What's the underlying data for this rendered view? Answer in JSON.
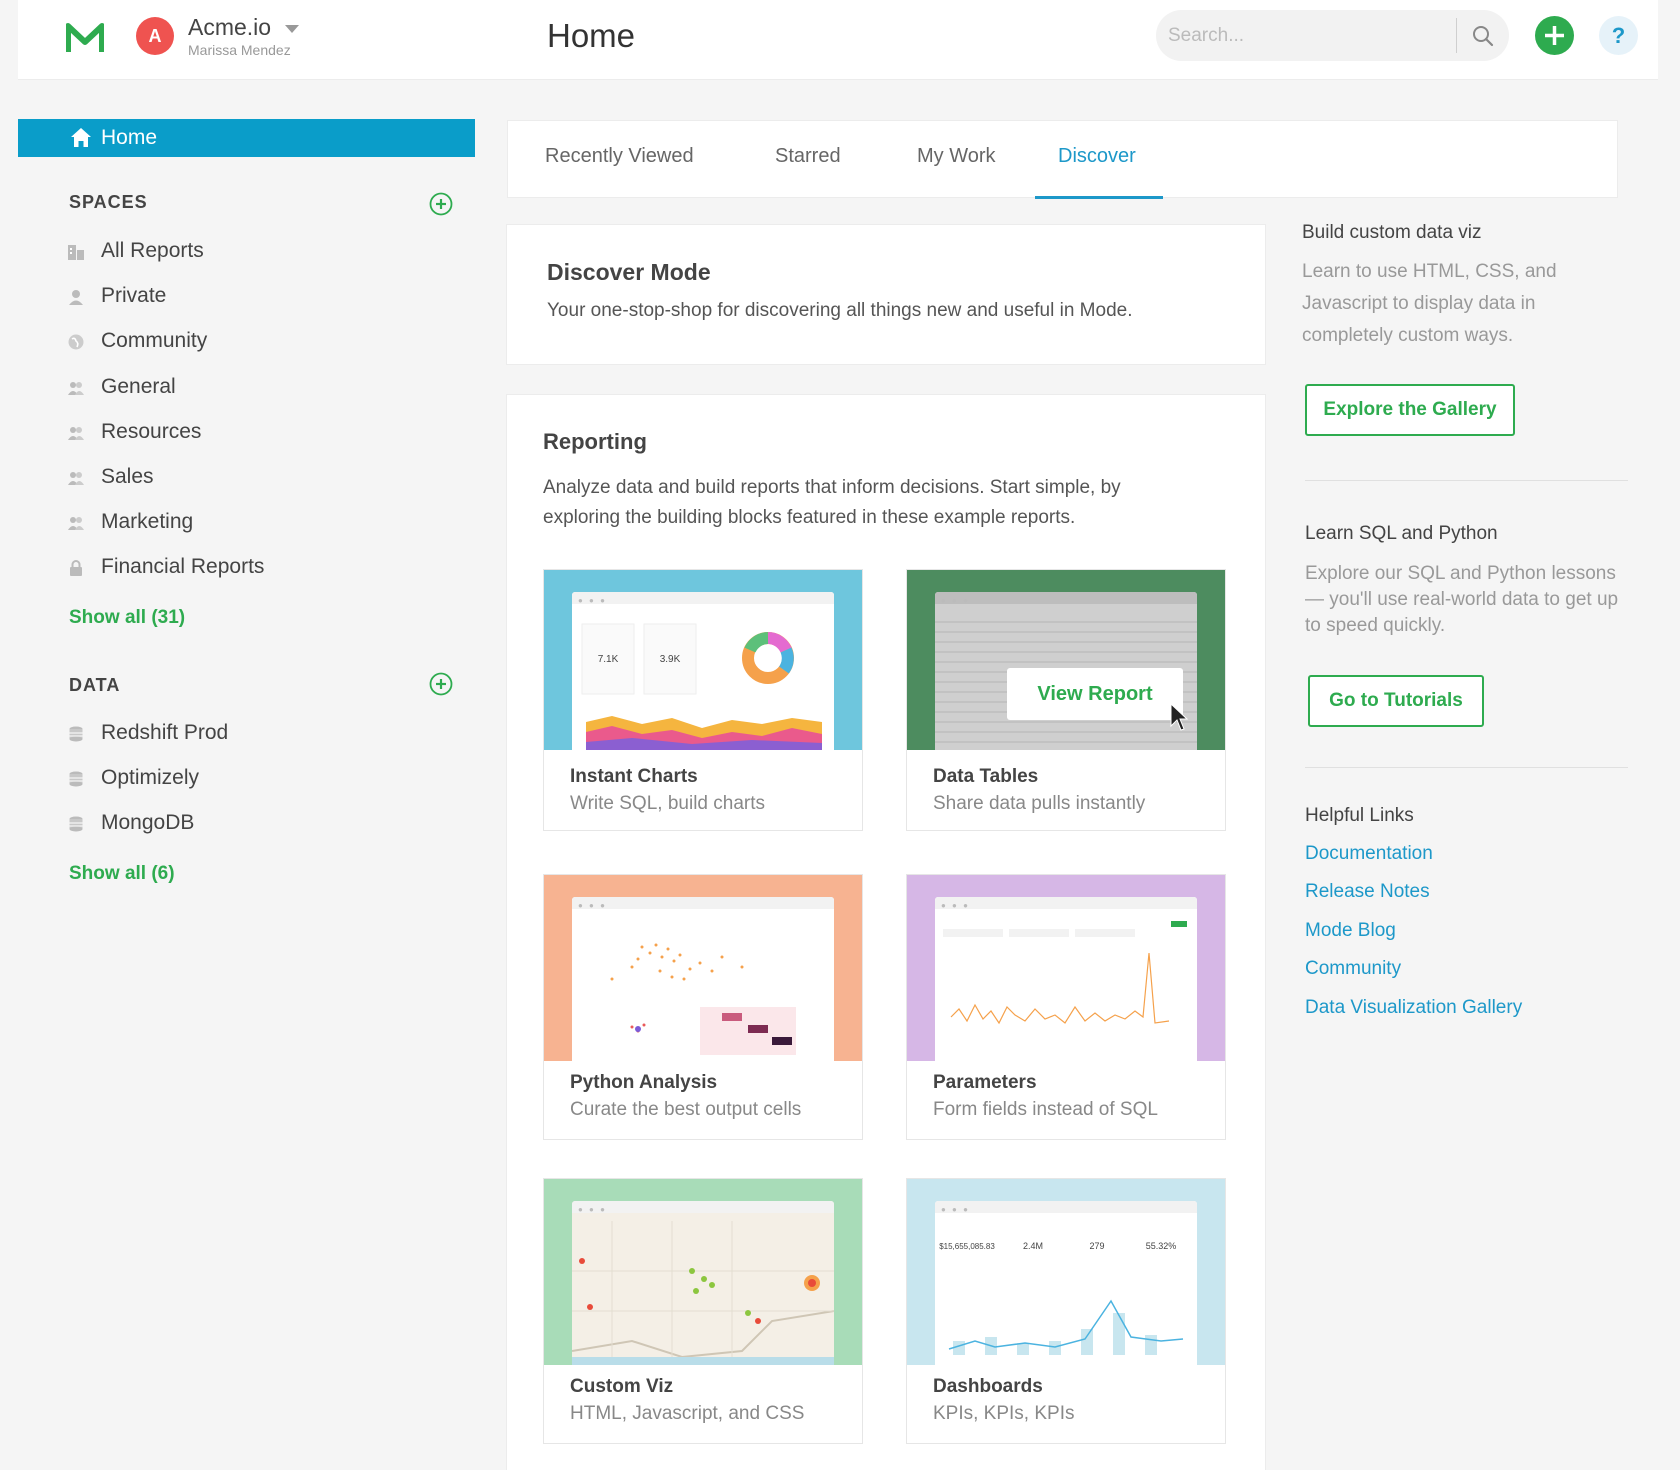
{
  "header": {
    "org_initial": "A",
    "org_name": "Acme.io",
    "user_name": "Marissa Mendez",
    "page_title": "Home",
    "search_placeholder": "Search..."
  },
  "colors": {
    "primary_blue": "#0a9dc9",
    "brand_green": "#2eab4f",
    "avatar_red": "#ef5350",
    "link_blue": "#1d98c9"
  },
  "sidebar": {
    "home_label": "Home",
    "spaces_title": "SPACES",
    "spaces": [
      {
        "label": "All Reports",
        "icon": "building-icon"
      },
      {
        "label": "Private",
        "icon": "person-icon"
      },
      {
        "label": "Community",
        "icon": "globe-icon"
      },
      {
        "label": "General",
        "icon": "group-icon"
      },
      {
        "label": "Resources",
        "icon": "group-icon"
      },
      {
        "label": "Sales",
        "icon": "group-icon"
      },
      {
        "label": "Marketing",
        "icon": "group-icon"
      },
      {
        "label": "Financial Reports",
        "icon": "lock-icon"
      }
    ],
    "spaces_show_all": "Show all (31)",
    "data_title": "DATA",
    "data_sources": [
      {
        "label": "Redshift Prod",
        "icon": "database-icon"
      },
      {
        "label": "Optimizely",
        "icon": "database-icon"
      },
      {
        "label": "MongoDB",
        "icon": "database-icon"
      }
    ],
    "data_show_all": "Show all (6)"
  },
  "tabs": [
    {
      "label": "Recently Viewed",
      "active": false
    },
    {
      "label": "Starred",
      "active": false
    },
    {
      "label": "My Work",
      "active": false
    },
    {
      "label": "Discover",
      "active": true
    }
  ],
  "discover": {
    "title": "Discover Mode",
    "description": "Your one-stop-shop for discovering all things new and useful in Mode."
  },
  "reporting": {
    "title": "Reporting",
    "description": "Analyze data and build reports that inform decisions. Start simple, by exploring the building blocks featured in these example reports.",
    "view_report_label": "View Report",
    "thumb_kpis": {
      "instant_charts": [
        "7.1K",
        "3.9K"
      ],
      "dashboards": [
        "$15,655,085.83",
        "2.4M",
        "279",
        "55.32%"
      ]
    },
    "cards": [
      {
        "title": "Instant Charts",
        "subtitle": "Write SQL, build charts",
        "color": "#6ec6dd"
      },
      {
        "title": "Data Tables",
        "subtitle": "Share data pulls instantly",
        "color": "#4d8c5f"
      },
      {
        "title": "Python Analysis",
        "subtitle": "Curate the best output cells",
        "color": "#f7b391"
      },
      {
        "title": "Parameters",
        "subtitle": "Form fields instead of SQL",
        "color": "#d6b7e6"
      },
      {
        "title": "Custom Viz",
        "subtitle": "HTML, Javascript, and CSS",
        "color": "#a8dcb8"
      },
      {
        "title": "Dashboards",
        "subtitle": "KPIs, KPIs, KPIs",
        "color": "#c8e6ef"
      }
    ]
  },
  "right": {
    "viz_title": "Build custom data viz",
    "viz_text": "Learn to use HTML, CSS, and Javascript to display data in completely custom ways.",
    "gallery_button": "Explore the Gallery",
    "sql_title": "Learn SQL and Python",
    "sql_text": "Explore our SQL and Python lessons — you'll use real-world data to get up to speed quickly.",
    "tutorials_button": "Go to Tutorials",
    "links_title": "Helpful Links",
    "links": [
      "Documentation",
      "Release Notes",
      "Mode Blog",
      "Community",
      "Data Visualization Gallery"
    ]
  }
}
